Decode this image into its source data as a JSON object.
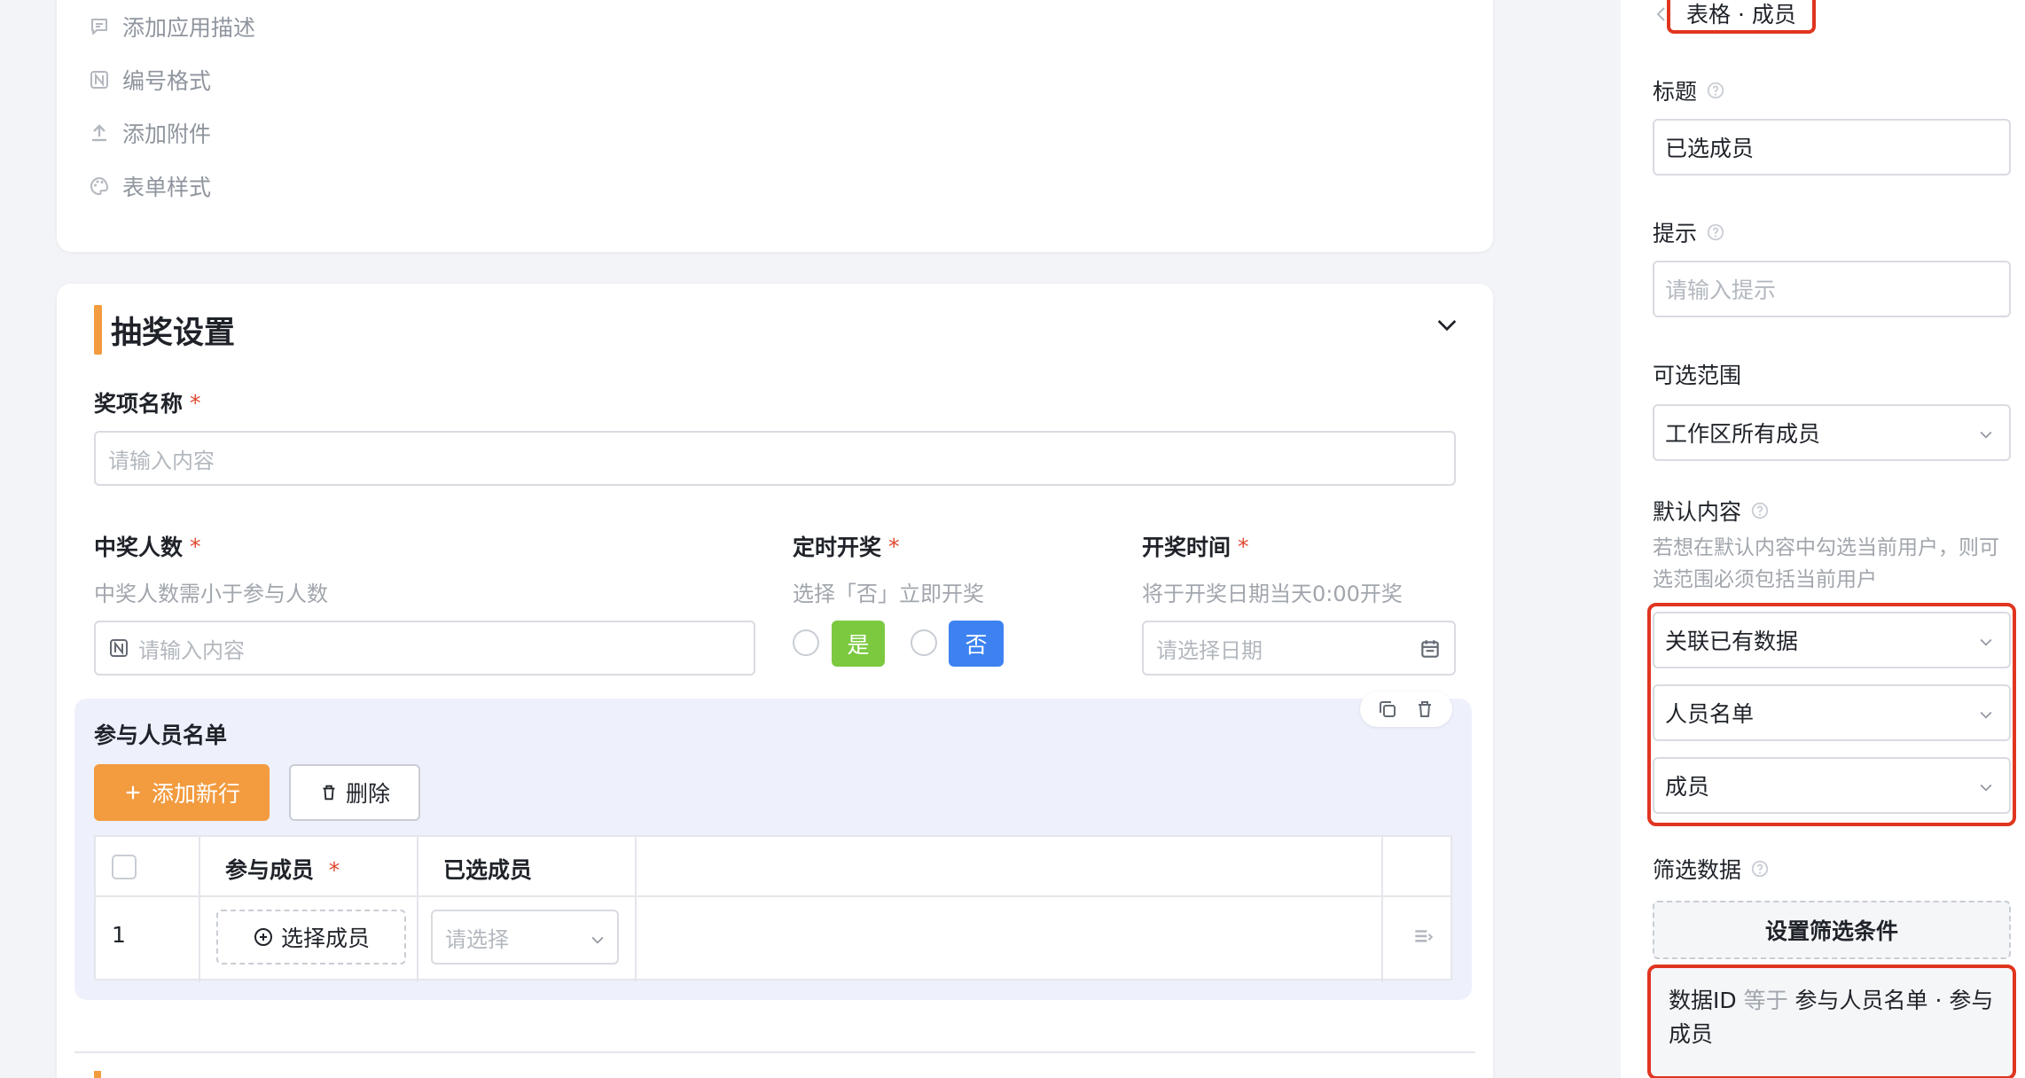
{
  "top_options": [
    {
      "label": "添加应用描述",
      "icon": "comment-icon"
    },
    {
      "label": "编号格式",
      "icon": "number-format-icon"
    },
    {
      "label": "添加附件",
      "icon": "upload-icon"
    },
    {
      "label": "表单样式",
      "icon": "palette-icon"
    }
  ],
  "section": {
    "title": "抽奖设置",
    "prize_name": {
      "label": "奖项名称",
      "required": "*",
      "placeholder": "请输入内容"
    },
    "winner_count": {
      "label": "中奖人数",
      "required": "*",
      "hint": "中奖人数需小于参与人数",
      "placeholder": "请输入内容"
    },
    "timed_draw": {
      "label": "定时开奖",
      "required": "*",
      "hint": "选择「否」立即开奖",
      "yes": "是",
      "no": "否"
    },
    "draw_time": {
      "label": "开奖时间",
      "required": "*",
      "hint": "将于开奖日期当天0:00开奖",
      "placeholder": "请选择日期"
    }
  },
  "subtable": {
    "title": "参与人员名单",
    "add_row": "添加新行",
    "delete": "删除",
    "columns": {
      "member": "参与成员",
      "member_required": "*",
      "selected": "已选成员"
    },
    "row": {
      "index": "1",
      "select_member": "选择成员",
      "select_placeholder": "请选择"
    }
  },
  "panel": {
    "breadcrumb": "表格 · 成员",
    "title_label": "标题",
    "title_value": "已选成员",
    "hint_label": "提示",
    "hint_placeholder": "请输入提示",
    "range_label": "可选范围",
    "range_value": "工作区所有成员",
    "default_label": "默认内容",
    "default_hint": "若想在默认内容中勾选当前用户，则可选范围必须包括当前用户",
    "default_source": "关联已有数据",
    "default_table": "人员名单",
    "default_field": "成员",
    "filter_label": "筛选数据",
    "filter_button": "设置筛选条件",
    "condition": {
      "field": "数据ID",
      "op": "等于",
      "value": "参与人员名单 · 参与成员"
    }
  },
  "colors": {
    "accent_orange": "#f29b3f",
    "yes_green": "#7cc940",
    "no_blue": "#3d82f0",
    "highlight_red": "#e0351f"
  }
}
